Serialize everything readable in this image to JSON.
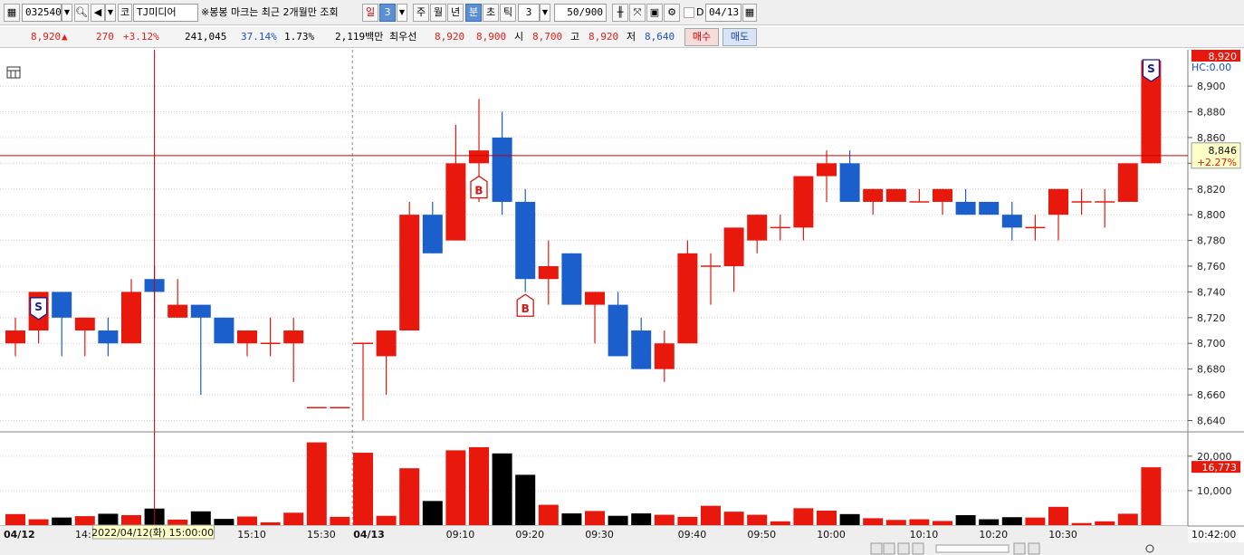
{
  "toolbar": {
    "code": "032540",
    "market_btn": "코",
    "stock_name": "TJ미디어",
    "notice": "※봉봉 마크는 최근 2개월만 조회",
    "period_day": "일",
    "period_day_value": "3",
    "period_week": "주",
    "period_month": "월",
    "period_year": "년",
    "period_minute": "분",
    "period_second": "초",
    "period_tick": "틱",
    "interval_value": "3",
    "count_value": "50/900",
    "d_label": "D",
    "date_value": "04/13"
  },
  "quote": {
    "price": "8,920",
    "change_arrow": "▲",
    "change": "270",
    "change_pct": "+3.12%",
    "volume": "241,045",
    "vol_ratio": "37.14%",
    "turnover": "1.73%",
    "amount": "2,119백만",
    "best_ask_label": "최우선",
    "best_ask": "8,920",
    "best_bid": "8,900",
    "open_label": "시",
    "open": "8,700",
    "high_label": "고",
    "high": "8,920",
    "low_label": "저",
    "low": "8,640",
    "buy_label": "매수",
    "sell_label": "매도"
  },
  "colors": {
    "up": "#e8190c",
    "down": "#1a5fcc",
    "volume_down": "#000000",
    "crosshair": "#cc0000"
  },
  "chart_data": {
    "type": "candlestick",
    "interval": "3분",
    "y_ticks": [
      "8,640",
      "8,660",
      "8,680",
      "8,700",
      "8,720",
      "8,740",
      "8,760",
      "8,780",
      "8,800",
      "8,820",
      "8,840",
      "8,860",
      "8,880",
      "8,900"
    ],
    "y_range": [
      8634,
      8924
    ],
    "current_price_label": "8,920",
    "hc_label": "HC:0.00",
    "crosshair_price_label": "8,846",
    "crosshair_pct_label": "+2.27%",
    "crosshair_price": 8846,
    "crosshair_time_label": "2022/04/12(화) 15:00:00",
    "volume_ticks": [
      "20,000",
      "10,000"
    ],
    "volume_range": [
      0,
      26000
    ],
    "volume_last_label": "16,773",
    "x_labels": [
      {
        "i": 0,
        "text": "04/12",
        "bold": true
      },
      {
        "i": 3,
        "text": "14:"
      },
      {
        "i": 10,
        "text": "15:10"
      },
      {
        "i": 13,
        "text": "15:30"
      },
      {
        "i": 15,
        "text": "04/13",
        "bold": true
      },
      {
        "i": 19,
        "text": "09:10"
      },
      {
        "i": 22,
        "text": "09:20"
      },
      {
        "i": 25,
        "text": "09:30"
      },
      {
        "i": 29,
        "text": "09:40"
      },
      {
        "i": 32,
        "text": "09:50"
      },
      {
        "i": 35,
        "text": "10:00"
      },
      {
        "i": 39,
        "text": "10:10"
      },
      {
        "i": 42,
        "text": "10:20"
      },
      {
        "i": 45,
        "text": "10:30"
      },
      {
        "i": 49,
        "text": "10:42:00"
      }
    ],
    "candles": [
      {
        "o": 8700,
        "h": 8720,
        "l": 8690,
        "c": 8710,
        "v": 3200
      },
      {
        "o": 8710,
        "h": 8740,
        "l": 8700,
        "c": 8740,
        "v": 1700
      },
      {
        "o": 8740,
        "h": 8740,
        "l": 8690,
        "c": 8720,
        "v": 2200
      },
      {
        "o": 8710,
        "h": 8720,
        "l": 8690,
        "c": 8720,
        "v": 2600
      },
      {
        "o": 8710,
        "h": 8720,
        "l": 8690,
        "c": 8700,
        "v": 3300
      },
      {
        "o": 8700,
        "h": 8750,
        "l": 8700,
        "c": 8740,
        "v": 2900
      },
      {
        "o": 8750,
        "h": 8760,
        "l": 8720,
        "c": 8740,
        "v": 4800
      },
      {
        "o": 8720,
        "h": 8750,
        "l": 8720,
        "c": 8730,
        "v": 1600
      },
      {
        "o": 8730,
        "h": 8730,
        "l": 8660,
        "c": 8720,
        "v": 4000
      },
      {
        "o": 8720,
        "h": 8720,
        "l": 8700,
        "c": 8700,
        "v": 1800
      },
      {
        "o": 8700,
        "h": 8710,
        "l": 8690,
        "c": 8710,
        "v": 2500
      },
      {
        "o": 8700,
        "h": 8720,
        "l": 8690,
        "c": 8700,
        "v": 800
      },
      {
        "o": 8700,
        "h": 8720,
        "l": 8670,
        "c": 8710,
        "v": 3600
      },
      {
        "o": 8650,
        "h": 8650,
        "l": 8650,
        "c": 8650,
        "v": 24000
      },
      {
        "o": 8650,
        "h": 8650,
        "l": 8650,
        "c": 8650,
        "v": 2400
      },
      {
        "o": 8700,
        "h": 8700,
        "l": 8640,
        "c": 8700,
        "v": 21000
      },
      {
        "o": 8690,
        "h": 8710,
        "l": 8660,
        "c": 8710,
        "v": 2700
      },
      {
        "o": 8710,
        "h": 8810,
        "l": 8710,
        "c": 8800,
        "v": 16500
      },
      {
        "o": 8800,
        "h": 8810,
        "l": 8770,
        "c": 8770,
        "v": 7000
      },
      {
        "o": 8780,
        "h": 8870,
        "l": 8780,
        "c": 8840,
        "v": 21700
      },
      {
        "o": 8840,
        "h": 8890,
        "l": 8810,
        "c": 8850,
        "v": 22600
      },
      {
        "o": 8860,
        "h": 8880,
        "l": 8800,
        "c": 8810,
        "v": 20800
      },
      {
        "o": 8810,
        "h": 8820,
        "l": 8740,
        "c": 8750,
        "v": 14600
      },
      {
        "o": 8750,
        "h": 8780,
        "l": 8730,
        "c": 8760,
        "v": 5900
      },
      {
        "o": 8770,
        "h": 8770,
        "l": 8730,
        "c": 8730,
        "v": 3400
      },
      {
        "o": 8730,
        "h": 8740,
        "l": 8700,
        "c": 8740,
        "v": 4100
      },
      {
        "o": 8730,
        "h": 8740,
        "l": 8690,
        "c": 8690,
        "v": 2700
      },
      {
        "o": 8710,
        "h": 8720,
        "l": 8680,
        "c": 8680,
        "v": 3400
      },
      {
        "o": 8680,
        "h": 8710,
        "l": 8670,
        "c": 8700,
        "v": 3000
      },
      {
        "o": 8700,
        "h": 8780,
        "l": 8700,
        "c": 8770,
        "v": 2400
      },
      {
        "o": 8760,
        "h": 8770,
        "l": 8730,
        "c": 8760,
        "v": 5600
      },
      {
        "o": 8760,
        "h": 8790,
        "l": 8740,
        "c": 8790,
        "v": 3900
      },
      {
        "o": 8780,
        "h": 8800,
        "l": 8770,
        "c": 8800,
        "v": 3000
      },
      {
        "o": 8790,
        "h": 8800,
        "l": 8780,
        "c": 8790,
        "v": 1100
      },
      {
        "o": 8790,
        "h": 8830,
        "l": 8780,
        "c": 8830,
        "v": 4900
      },
      {
        "o": 8830,
        "h": 8850,
        "l": 8810,
        "c": 8840,
        "v": 4200
      },
      {
        "o": 8840,
        "h": 8850,
        "l": 8810,
        "c": 8810,
        "v": 3200
      },
      {
        "o": 8810,
        "h": 8820,
        "l": 8800,
        "c": 8820,
        "v": 2000
      },
      {
        "o": 8810,
        "h": 8820,
        "l": 8810,
        "c": 8820,
        "v": 1500
      },
      {
        "o": 8810,
        "h": 8820,
        "l": 8810,
        "c": 8810,
        "v": 1700
      },
      {
        "o": 8810,
        "h": 8820,
        "l": 8800,
        "c": 8820,
        "v": 1200
      },
      {
        "o": 8810,
        "h": 8820,
        "l": 8800,
        "c": 8800,
        "v": 2900
      },
      {
        "o": 8810,
        "h": 8810,
        "l": 8800,
        "c": 8800,
        "v": 1700
      },
      {
        "o": 8800,
        "h": 8810,
        "l": 8780,
        "c": 8790,
        "v": 2300
      },
      {
        "o": 8790,
        "h": 8800,
        "l": 8780,
        "c": 8790,
        "v": 2200
      },
      {
        "o": 8800,
        "h": 8820,
        "l": 8780,
        "c": 8820,
        "v": 5300
      },
      {
        "o": 8810,
        "h": 8820,
        "l": 8800,
        "c": 8810,
        "v": 600
      },
      {
        "o": 8810,
        "h": 8820,
        "l": 8790,
        "c": 8810,
        "v": 1100
      },
      {
        "o": 8810,
        "h": 8840,
        "l": 8810,
        "c": 8840,
        "v": 3300
      },
      {
        "o": 8840,
        "h": 8920,
        "l": 8840,
        "c": 8920,
        "v": 16773
      }
    ],
    "markers": [
      {
        "i": 1,
        "type": "S",
        "price": 8720,
        "above": false
      },
      {
        "i": 20,
        "type": "B",
        "price": 8830,
        "above": false
      },
      {
        "i": 22,
        "type": "B",
        "price": 8738,
        "above": false
      },
      {
        "i": 49,
        "type": "S",
        "price": 8905,
        "above": false
      }
    ]
  }
}
